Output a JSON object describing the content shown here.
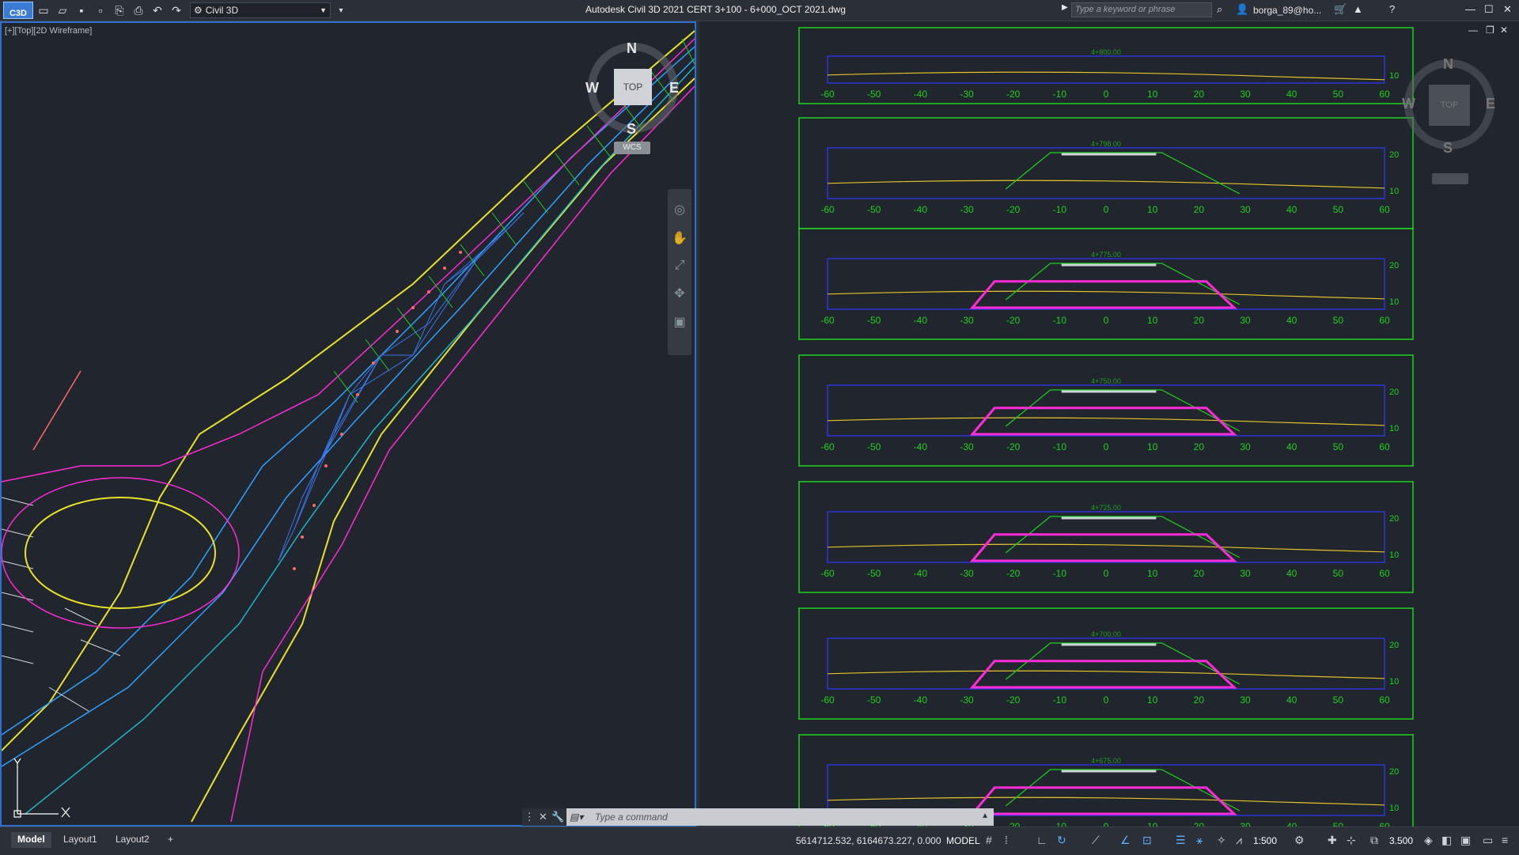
{
  "app": {
    "title": "Autodesk Civil 3D 2021    CERT 3+100 - 6+000_OCT 2021.dwg",
    "workspace": "Civil 3D",
    "logo_text": "C3D",
    "search_placeholder": "Type a keyword or phrase",
    "user": "borga_89@ho..."
  },
  "viewport_left": {
    "label": "[+][Top][2D Wireframe]",
    "viewcube": {
      "n": "N",
      "s": "S",
      "e": "E",
      "w": "W",
      "face": "TOP",
      "wcs": "WCS"
    }
  },
  "viewport_right": {
    "viewcube": {
      "n": "N",
      "s": "S",
      "e": "E",
      "w": "W",
      "face": "TOP"
    }
  },
  "cross_sections": {
    "x_ticks": [
      "-60",
      "-50",
      "-40",
      "-30",
      "-20",
      "-10",
      "0",
      "10",
      "20",
      "30",
      "40",
      "50",
      "60"
    ],
    "sections": [
      {
        "station": "4+800.00",
        "y_ticks": [
          "10"
        ]
      },
      {
        "station": "4+798.00",
        "y_ticks": [
          "20",
          "10"
        ]
      },
      {
        "station": "4+775.00",
        "y_ticks": [
          "20",
          "10"
        ]
      },
      {
        "station": "4+750.00",
        "y_ticks": [
          "20",
          "10"
        ]
      },
      {
        "station": "4+725.00",
        "y_ticks": [
          "20",
          "10"
        ]
      },
      {
        "station": "4+700.00",
        "y_ticks": [
          "20",
          "10"
        ]
      },
      {
        "station": "4+675.00",
        "y_ticks": [
          "20",
          "10"
        ]
      }
    ]
  },
  "command_line": {
    "placeholder": "Type a command"
  },
  "status": {
    "tabs": [
      "Model",
      "Layout1",
      "Layout2"
    ],
    "add_tab": "+",
    "coordinates": "5614712.532, 6164673.227, 0.000",
    "space": "MODEL",
    "scale": "1:500",
    "annotation_scale": "3.500"
  },
  "colors": {
    "accent": "#2f6fcf",
    "frame": "#1fd11f",
    "profile": "#ff2bd6",
    "grid": "#2a35d8"
  }
}
